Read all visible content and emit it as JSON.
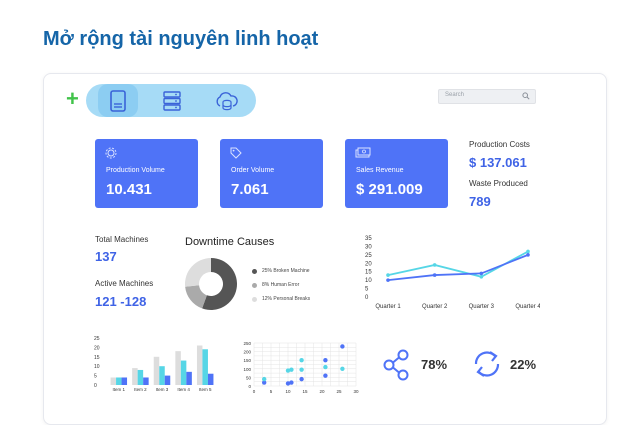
{
  "heading": "Mở rộng tài nguyên linh hoạt",
  "toolbar": {
    "add_icon": "plus-icon",
    "icons": [
      "server-icon",
      "server-rack-icon",
      "cloud-database-icon"
    ],
    "search_placeholder": "Search"
  },
  "kpis": [
    {
      "label": "Production Volume",
      "value": "10.431",
      "icon": "cog-icon"
    },
    {
      "label": "Order Volume",
      "value": "7.061",
      "icon": "tag-icon"
    },
    {
      "label": "Sales Revenue",
      "value": "$ 291.009",
      "icon": "banknote-icon"
    }
  ],
  "side_stats": {
    "production_costs_label": "Production Costs",
    "production_costs_value": "$ 137.061",
    "waste_label": "Waste Produced",
    "waste_value": "789"
  },
  "machines": {
    "total_label": "Total Machines",
    "total_value": "137",
    "active_label": "Active Machines",
    "active_value": "121 -128"
  },
  "colors": {
    "blue": "#4f73f7",
    "cyan": "#56d6e6",
    "dark": "#555555",
    "gray": "#aaaaaa",
    "light": "#dddddd"
  },
  "chart_data": [
    {
      "type": "pie",
      "title": "Downtime Causes",
      "slices": [
        {
          "label": "25% Broken Machine",
          "value": 25,
          "color": "#555555"
        },
        {
          "label": "8% Human Error",
          "value": 8,
          "color": "#aaaaaa"
        },
        {
          "label": "12% Personal Breaks",
          "value": 12,
          "color": "#dddddd"
        }
      ]
    },
    {
      "type": "line",
      "categories": [
        "Quarter 1",
        "Quarter 2",
        "Quarter 3",
        "Quarter 4"
      ],
      "yticks": [
        "0",
        "5",
        "10",
        "15",
        "20",
        "25",
        "30",
        "35"
      ],
      "ylim": [
        0,
        35
      ],
      "series": [
        {
          "values": [
            13,
            19,
            12,
            27
          ],
          "color": "#56d6e6"
        },
        {
          "values": [
            10,
            13,
            14,
            25
          ],
          "color": "#4f73f7"
        }
      ]
    },
    {
      "type": "bar",
      "categories": [
        "Item 1",
        "Item 2",
        "Item 3",
        "Item 4",
        "Item 5"
      ],
      "yticks": [
        "0",
        "5",
        "10",
        "15",
        "20",
        "25"
      ],
      "ylim": [
        0,
        25
      ],
      "series": [
        {
          "values": [
            4,
            9,
            15,
            18,
            21
          ],
          "color": "#dddddd"
        },
        {
          "values": [
            4,
            8,
            10,
            13,
            19
          ],
          "color": "#56d6e6"
        },
        {
          "values": [
            4,
            4,
            5,
            7,
            6
          ],
          "color": "#4f73f7"
        }
      ]
    },
    {
      "type": "scatter",
      "xticks": [
        "0",
        "5",
        "10",
        "15",
        "20",
        "25",
        "30"
      ],
      "yticks": [
        "0",
        "50",
        "100",
        "150",
        "200",
        "250"
      ],
      "xlim": [
        0,
        30
      ],
      "ylim": [
        0,
        250
      ],
      "series": [
        {
          "points": [
            [
              3,
              20
            ],
            [
              10,
              15
            ],
            [
              11,
              20
            ],
            [
              14,
              40
            ],
            [
              21,
              60
            ],
            [
              21,
              150
            ],
            [
              26,
              230
            ]
          ],
          "color": "#4f73f7"
        },
        {
          "points": [
            [
              3,
              40
            ],
            [
              10,
              90
            ],
            [
              11,
              95
            ],
            [
              14,
              150
            ],
            [
              21,
              110
            ],
            [
              26,
              100
            ],
            [
              14,
              95
            ]
          ],
          "color": "#56d6e6"
        }
      ]
    }
  ],
  "percent_stats": [
    {
      "icon": "share-icon",
      "value": "78%"
    },
    {
      "icon": "sync-icon",
      "value": "22%"
    }
  ]
}
